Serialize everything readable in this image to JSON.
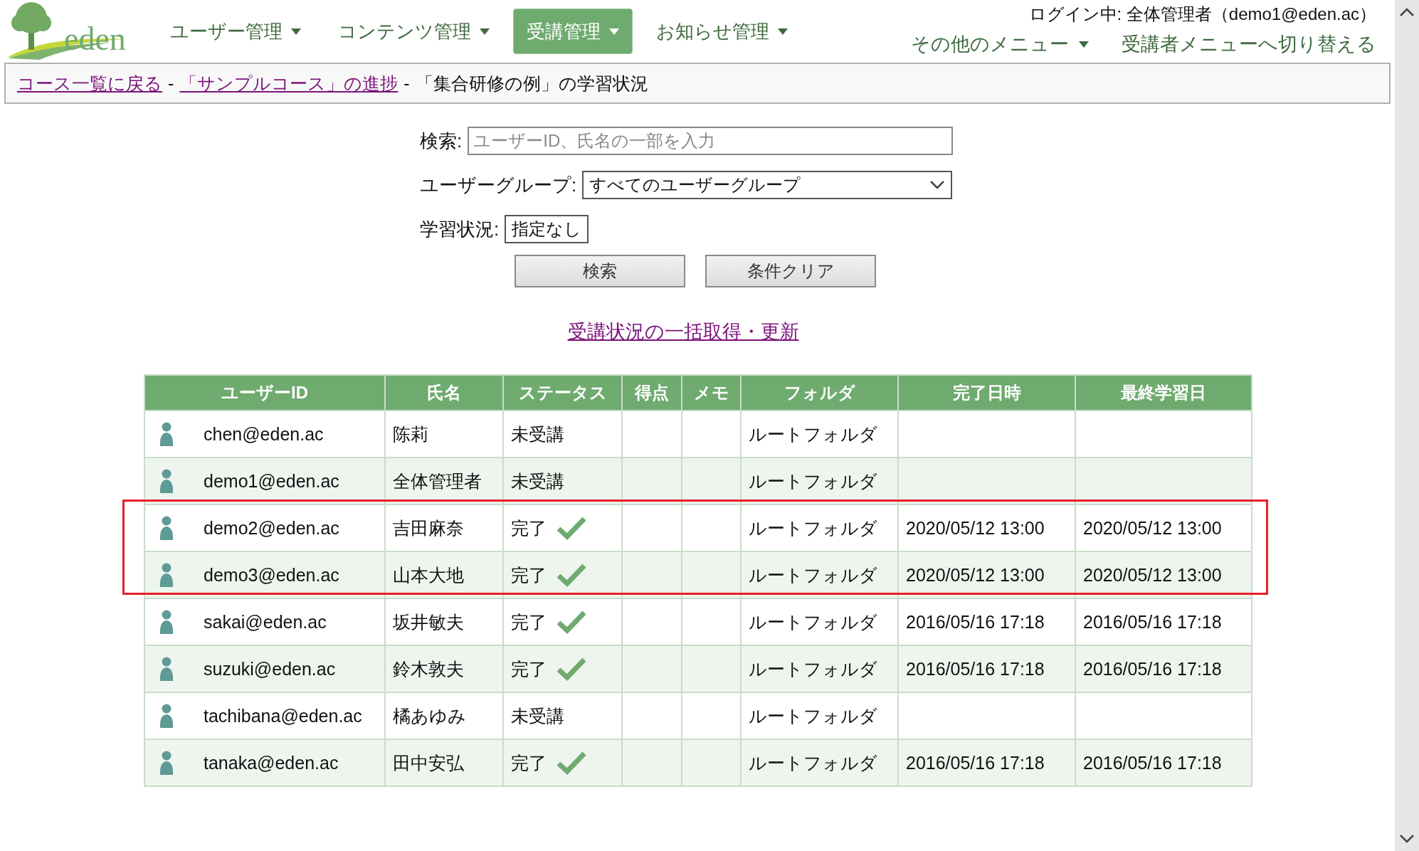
{
  "header": {
    "logo_text": "eden",
    "nav": [
      {
        "label": "ユーザー管理",
        "selected": false
      },
      {
        "label": "コンテンツ管理",
        "selected": false
      },
      {
        "label": "受講管理",
        "selected": true
      },
      {
        "label": "お知らせ管理",
        "selected": false
      }
    ],
    "login": "ログイン中: 全体管理者（demo1@eden.ac）",
    "other_menu": "その他のメニュー",
    "switch_link": "受講者メニューへ切り替える"
  },
  "breadcrumb": {
    "links": [
      "コース一覧に戻る",
      "「サンプルコース」の進捗"
    ],
    "separator": "-",
    "current": "「集合研修の例」の学習状況"
  },
  "search": {
    "label": "検索:",
    "placeholder": "ユーザーID、氏名の一部を入力",
    "group_label": "ユーザーグループ:",
    "group_value": "すべてのユーザーグループ",
    "status_label": "学習状況:",
    "status_value": "指定なし",
    "buttons": [
      "検索",
      "条件クリア"
    ]
  },
  "bulk_link": "受講状況の一括取得・更新",
  "table": {
    "columns": [
      "ユーザーID",
      "氏名",
      "ステータス",
      "得点",
      "メモ",
      "フォルダ",
      "完了日時",
      "最終学習日"
    ],
    "rows": [
      {
        "user_id": "chen@eden.ac",
        "name": "陈莉",
        "status": "未受講",
        "completed": false,
        "folder": "ルートフォルダ",
        "done_at": "",
        "last": "",
        "highlighted": false
      },
      {
        "user_id": "demo1@eden.ac",
        "name": "全体管理者",
        "status": "未受講",
        "completed": false,
        "folder": "ルートフォルダ",
        "done_at": "",
        "last": "",
        "highlighted": false
      },
      {
        "user_id": "demo2@eden.ac",
        "name": "吉田麻奈",
        "status": "完了",
        "completed": true,
        "folder": "ルートフォルダ",
        "done_at": "2020/05/12 13:00",
        "last": "2020/05/12 13:00",
        "highlighted": true
      },
      {
        "user_id": "demo3@eden.ac",
        "name": "山本大地",
        "status": "完了",
        "completed": true,
        "folder": "ルートフォルダ",
        "done_at": "2020/05/12 13:00",
        "last": "2020/05/12 13:00",
        "highlighted": true
      },
      {
        "user_id": "sakai@eden.ac",
        "name": "坂井敏夫",
        "status": "完了",
        "completed": true,
        "folder": "ルートフォルダ",
        "done_at": "2016/05/16 17:18",
        "last": "2016/05/16 17:18",
        "highlighted": false
      },
      {
        "user_id": "suzuki@eden.ac",
        "name": "鈴木敦夫",
        "status": "完了",
        "completed": true,
        "folder": "ルートフォルダ",
        "done_at": "2016/05/16 17:18",
        "last": "2016/05/16 17:18",
        "highlighted": false
      },
      {
        "user_id": "tachibana@eden.ac",
        "name": "橘あゆみ",
        "status": "未受講",
        "completed": false,
        "folder": "ルートフォルダ",
        "done_at": "",
        "last": "",
        "highlighted": false
      },
      {
        "user_id": "tanaka@eden.ac",
        "name": "田中安弘",
        "status": "完了",
        "completed": true,
        "folder": "ルートフォルダ",
        "done_at": "2016/05/16 17:18",
        "last": "2016/05/16 17:18",
        "highlighted": false
      }
    ]
  }
}
